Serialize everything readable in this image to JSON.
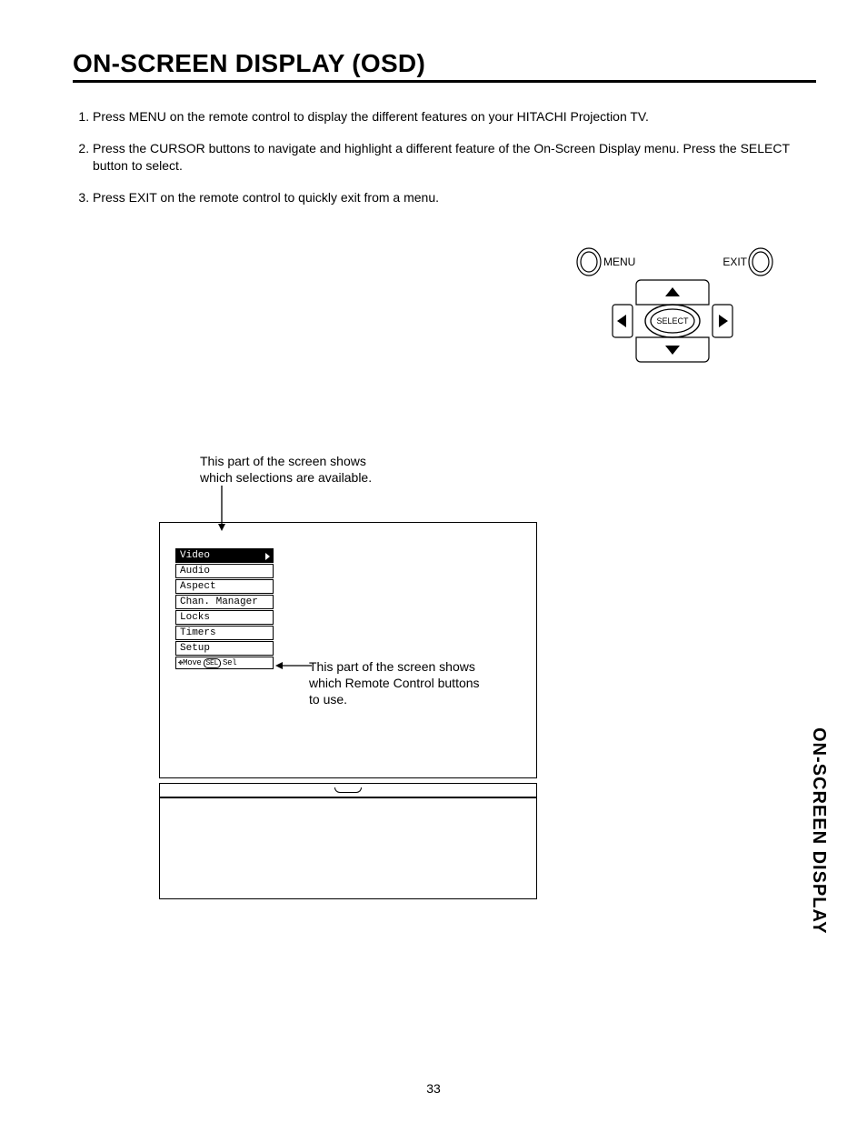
{
  "title": "ON-SCREEN DISPLAY (OSD)",
  "steps": {
    "s1": "Press MENU on the remote control to display the different features on your HITACHI Projection TV.",
    "s2": "Press the CURSOR buttons to navigate and highlight a different feature of the On-Screen Display menu. Press the SELECT button to select.",
    "s3": "Press EXIT on the remote control to quickly exit from a menu."
  },
  "remote": {
    "menu": "MENU",
    "exit": "EXIT",
    "select": "SELECT"
  },
  "captions": {
    "top1": "This part of the screen shows",
    "top2": "which selections are available.",
    "mid1": "This part of the screen shows",
    "mid2": "which Remote Control buttons",
    "mid3": "to use."
  },
  "menu": {
    "i0": "Video",
    "i1": "Audio",
    "i2": "Aspect",
    "i3": "Chan. Manager",
    "i4": "Locks",
    "i5": "Timers",
    "i6": "Setup",
    "hint_move": "Move",
    "hint_sel_btn": "SEL",
    "hint_sel": "Sel"
  },
  "sidetab": "ON-SCREEN DISPLAY",
  "page_number": "33"
}
